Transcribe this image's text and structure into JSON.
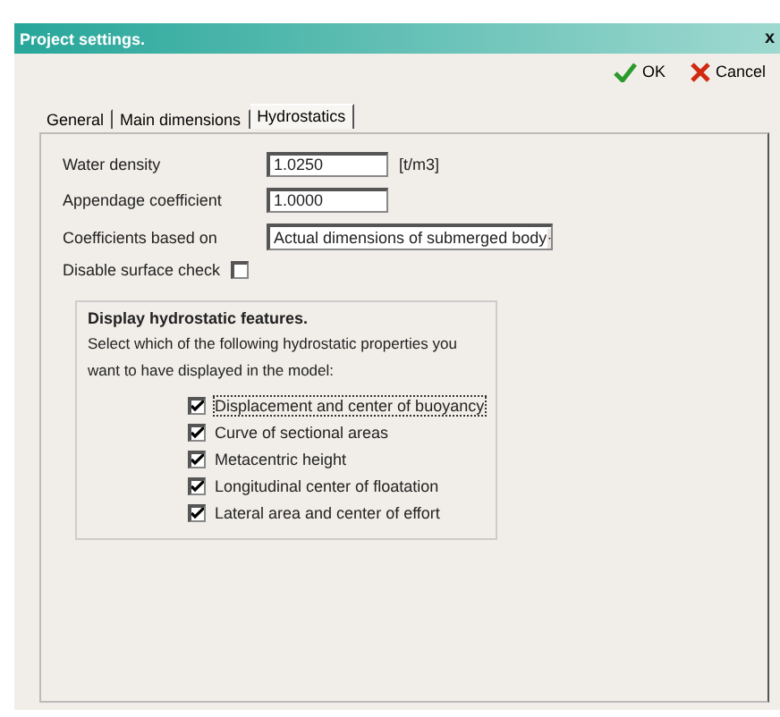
{
  "window": {
    "title": "Project settings.",
    "close": "x"
  },
  "toolbar": [
    {
      "kind": "ok",
      "label": "OK"
    },
    {
      "kind": "cancel",
      "label": "Cancel"
    }
  ],
  "tabs": [
    {
      "label": "General",
      "selected": false
    },
    {
      "label": "Main dimensions",
      "selected": false
    },
    {
      "label": "Hydrostatics",
      "selected": true
    }
  ],
  "fields": [
    {
      "label": "Water density",
      "value": "1.0250",
      "unit": "[t/m3]"
    },
    {
      "label": "Appendage coefficient",
      "value": "1.0000"
    }
  ],
  "coefficients": {
    "label": "Coefficients based on",
    "value": "Actual dimensions of submerged body"
  },
  "surface_check": {
    "label": "Disable surface check",
    "checked": false
  },
  "group": {
    "title": "Display hydrostatic features.",
    "description": "Select which of the following hydrostatic properties you want to have displayed in the model:",
    "options": [
      {
        "label": "Displacement and center of buoyancy",
        "checked": true,
        "focused": true
      },
      {
        "label": "Curve of sectional areas",
        "checked": true,
        "focused": false
      },
      {
        "label": "Metacentric height",
        "checked": true,
        "focused": false
      },
      {
        "label": "Longitudinal center of floatation",
        "checked": true,
        "focused": false
      },
      {
        "label": "Lateral area and center of effort",
        "checked": true,
        "focused": false
      }
    ]
  }
}
